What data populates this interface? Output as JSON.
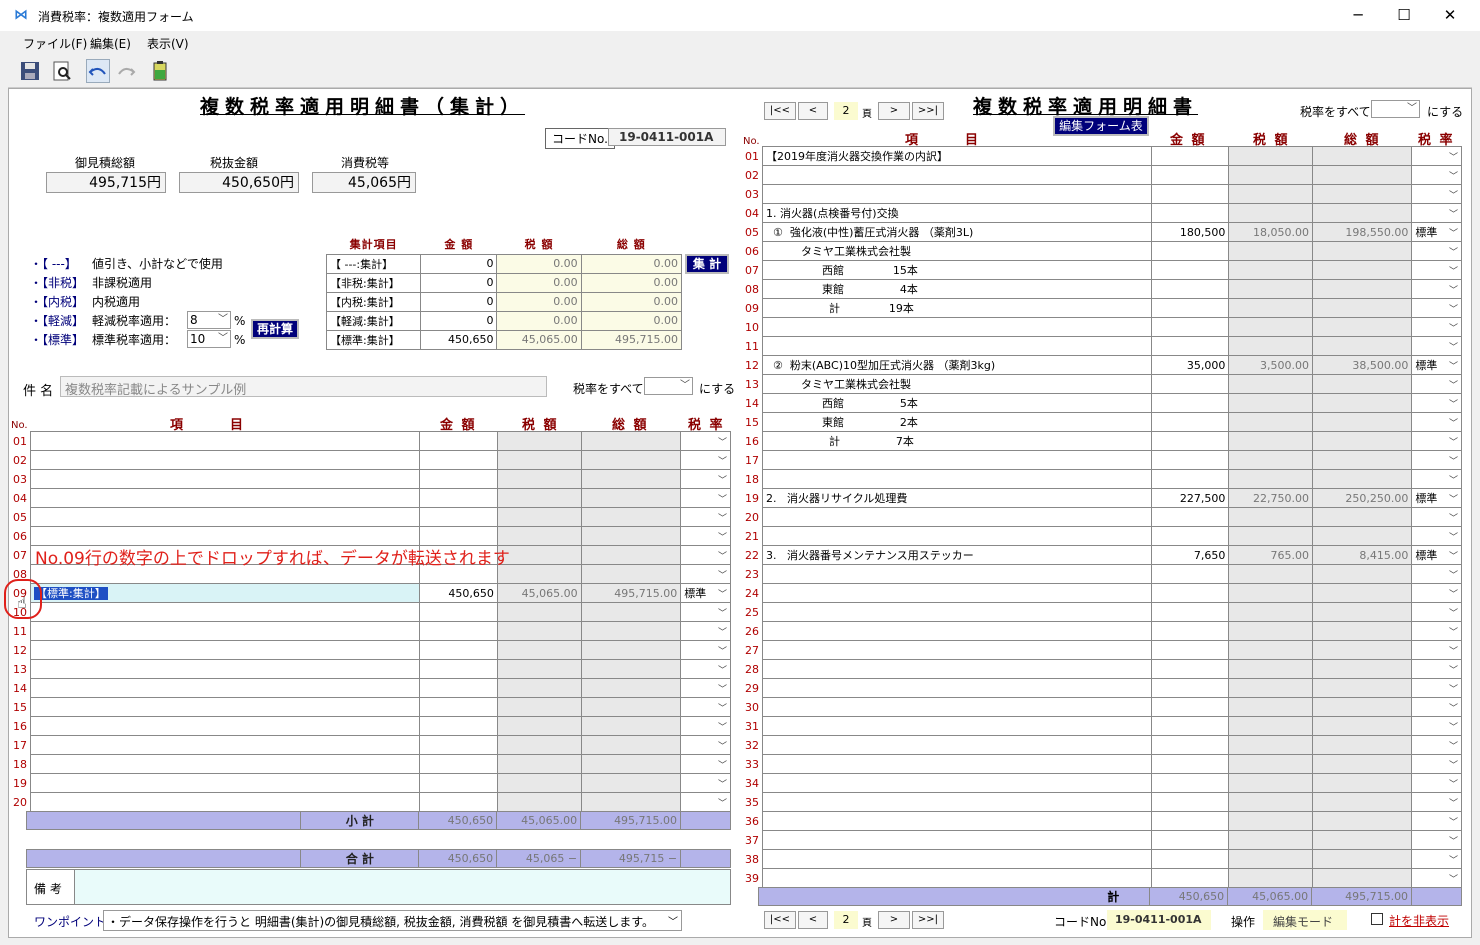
{
  "window": {
    "title": "消費税率：複数適用フォーム",
    "min": "─",
    "max": "☐",
    "close": "✕"
  },
  "menu": [
    "ファイル(F)",
    "編集(E)",
    "表示(V)"
  ],
  "left": {
    "title": "複数税率適用明細書（集計）",
    "code_label": "コードNo.",
    "code_value": "19-0411-001A",
    "totals": [
      {
        "label": "御見積総額",
        "value": "495,715円"
      },
      {
        "label": "税抜金額",
        "value": "450,650円"
      },
      {
        "label": "消費税等",
        "value": "45,065円"
      }
    ],
    "legend": [
      {
        "tag": "・【 ---】",
        "desc": "値引き、小計などで使用"
      },
      {
        "tag": "・【非税】",
        "desc": "非課税適用"
      },
      {
        "tag": "・【内税】",
        "desc": "内税適用"
      },
      {
        "tag": "・【軽減】",
        "desc": "軽減税率適用："
      },
      {
        "tag": "・【標準】",
        "desc": "標準税率適用："
      }
    ],
    "rate_reduced": "8",
    "rate_standard": "10",
    "pct": "%",
    "recalc": "再計算",
    "shukei": "集 計",
    "summary_headers": [
      "集計項目",
      "金 額",
      "税 額",
      "総 額"
    ],
    "summary": [
      [
        "【 ---:集計】",
        "0",
        "0.00",
        "0.00"
      ],
      [
        "【非税:集計】",
        "0",
        "0.00",
        "0.00"
      ],
      [
        "【内税:集計】",
        "0",
        "0.00",
        "0.00"
      ],
      [
        "【軽減:集計】",
        "0",
        "0.00",
        "0.00"
      ],
      [
        "【標準:集計】",
        "450,650",
        "45,065.00",
        "495,715.00"
      ]
    ],
    "subject_label": "件 名",
    "subject_value": "複数税率記載によるサンプル例",
    "rate_all_label": "税率をすべて",
    "rate_all_suffix": "にする",
    "cols": [
      "No.",
      "項　　　目",
      "金 額",
      "税 額",
      "総 額",
      "税 率"
    ],
    "row_nums": [
      "01",
      "02",
      "03",
      "04",
      "05",
      "06",
      "07",
      "08",
      "09",
      "10",
      "11",
      "12",
      "13",
      "14",
      "15",
      "16",
      "17",
      "18",
      "19",
      "20"
    ],
    "row09": {
      "item": "【標準:集計】",
      "amount": "450,650",
      "tax": "45,065.00",
      "total": "495,715.00",
      "rate": "標準"
    },
    "annotation": "No.09行の数字の上でドロップすれば、データが転送されます",
    "subtotal": {
      "label": "小 計",
      "amount": "450,650",
      "tax": "45,065.00",
      "total": "495,715.00"
    },
    "grand": {
      "label": "合 計",
      "amount": "450,650",
      "tax": "45,065 −",
      "total": "495,715 −"
    },
    "remarks_label": "備 考",
    "onepoint_label": "ワンポイント:",
    "onepoint_text": "・データ保存操作を行うと 明細書(集計)の御見積総額, 税抜金額, 消費税額 を御見積書へ転送します。"
  },
  "right": {
    "title": "複数税率適用明細書",
    "page": "2",
    "page_unit": "頁",
    "nav": [
      "|<<",
      "<",
      ">",
      ">>|"
    ],
    "edit_form": "編集フォーム表示",
    "rate_all_label": "税率をすべて",
    "rate_all_suffix": "にする",
    "cols": [
      "No.",
      "項　　　目",
      "金 額",
      "税 額",
      "総 額",
      "税 率"
    ],
    "rows": [
      {
        "n": "01",
        "item": "【2019年度消火器交換作業の内訳】",
        "a": "",
        "t": "",
        "s": "",
        "r": ""
      },
      {
        "n": "02",
        "item": "",
        "a": "",
        "t": "",
        "s": "",
        "r": ""
      },
      {
        "n": "03",
        "item": "",
        "a": "",
        "t": "",
        "s": "",
        "r": ""
      },
      {
        "n": "04",
        "item": "1. 消火器(点検番号付)交換",
        "a": "",
        "t": "",
        "s": "",
        "r": ""
      },
      {
        "n": "05",
        "item": "  ①  強化液(中性)蓄圧式消火器 （薬剤3L)",
        "a": "180,500",
        "t": "18,050.00",
        "s": "198,550.00",
        "r": "標準"
      },
      {
        "n": "06",
        "item": "          タミヤ工業株式会社製",
        "a": "",
        "t": "",
        "s": "",
        "r": ""
      },
      {
        "n": "07",
        "item": "                西館              15本",
        "a": "",
        "t": "",
        "s": "",
        "r": ""
      },
      {
        "n": "08",
        "item": "                東館                4本",
        "a": "",
        "t": "",
        "s": "",
        "r": ""
      },
      {
        "n": "09",
        "item": "                  計              19本",
        "a": "",
        "t": "",
        "s": "",
        "r": ""
      },
      {
        "n": "10",
        "item": "",
        "a": "",
        "t": "",
        "s": "",
        "r": ""
      },
      {
        "n": "11",
        "item": "",
        "a": "",
        "t": "",
        "s": "",
        "r": ""
      },
      {
        "n": "12",
        "item": "  ②  粉末(ABC)10型加圧式消火器 （薬剤3kg)",
        "a": "35,000",
        "t": "3,500.00",
        "s": "38,500.00",
        "r": "標準"
      },
      {
        "n": "13",
        "item": "          タミヤ工業株式会社製",
        "a": "",
        "t": "",
        "s": "",
        "r": ""
      },
      {
        "n": "14",
        "item": "                西館                5本",
        "a": "",
        "t": "",
        "s": "",
        "r": ""
      },
      {
        "n": "15",
        "item": "                東館                2本",
        "a": "",
        "t": "",
        "s": "",
        "r": ""
      },
      {
        "n": "16",
        "item": "                  計                7本",
        "a": "",
        "t": "",
        "s": "",
        "r": ""
      },
      {
        "n": "17",
        "item": "",
        "a": "",
        "t": "",
        "s": "",
        "r": ""
      },
      {
        "n": "18",
        "item": "",
        "a": "",
        "t": "",
        "s": "",
        "r": ""
      },
      {
        "n": "19",
        "item": "2.   消火器リサイクル処理費",
        "a": "227,500",
        "t": "22,750.00",
        "s": "250,250.00",
        "r": "標準"
      },
      {
        "n": "20",
        "item": "",
        "a": "",
        "t": "",
        "s": "",
        "r": ""
      },
      {
        "n": "21",
        "item": "",
        "a": "",
        "t": "",
        "s": "",
        "r": ""
      },
      {
        "n": "22",
        "item": "3.   消火器番号メンテナンス用ステッカー",
        "a": "7,650",
        "t": "765.00",
        "s": "8,415.00",
        "r": "標準"
      },
      {
        "n": "23",
        "item": "",
        "a": "",
        "t": "",
        "s": "",
        "r": ""
      },
      {
        "n": "24",
        "item": "",
        "a": "",
        "t": "",
        "s": "",
        "r": ""
      },
      {
        "n": "25",
        "item": "",
        "a": "",
        "t": "",
        "s": "",
        "r": ""
      },
      {
        "n": "26",
        "item": "",
        "a": "",
        "t": "",
        "s": "",
        "r": ""
      },
      {
        "n": "27",
        "item": "",
        "a": "",
        "t": "",
        "s": "",
        "r": ""
      },
      {
        "n": "28",
        "item": "",
        "a": "",
        "t": "",
        "s": "",
        "r": ""
      },
      {
        "n": "29",
        "item": "",
        "a": "",
        "t": "",
        "s": "",
        "r": ""
      },
      {
        "n": "30",
        "item": "",
        "a": "",
        "t": "",
        "s": "",
        "r": ""
      },
      {
        "n": "31",
        "item": "",
        "a": "",
        "t": "",
        "s": "",
        "r": ""
      },
      {
        "n": "32",
        "item": "",
        "a": "",
        "t": "",
        "s": "",
        "r": ""
      },
      {
        "n": "33",
        "item": "",
        "a": "",
        "t": "",
        "s": "",
        "r": ""
      },
      {
        "n": "34",
        "item": "",
        "a": "",
        "t": "",
        "s": "",
        "r": ""
      },
      {
        "n": "35",
        "item": "",
        "a": "",
        "t": "",
        "s": "",
        "r": ""
      },
      {
        "n": "36",
        "item": "",
        "a": "",
        "t": "",
        "s": "",
        "r": ""
      },
      {
        "n": "37",
        "item": "",
        "a": "",
        "t": "",
        "s": "",
        "r": ""
      },
      {
        "n": "38",
        "item": "",
        "a": "",
        "t": "",
        "s": "",
        "r": ""
      },
      {
        "n": "39",
        "item": "",
        "a": "",
        "t": "",
        "s": "",
        "r": ""
      }
    ],
    "total": {
      "label": "計",
      "amount": "450,650",
      "tax": "45,065.00",
      "total": "495,715.00"
    },
    "code_label": "コードNo.",
    "code_value": "19-0411-001A",
    "op_label": "操作",
    "mode": "編集モード",
    "hide_label": "計を非表示"
  }
}
